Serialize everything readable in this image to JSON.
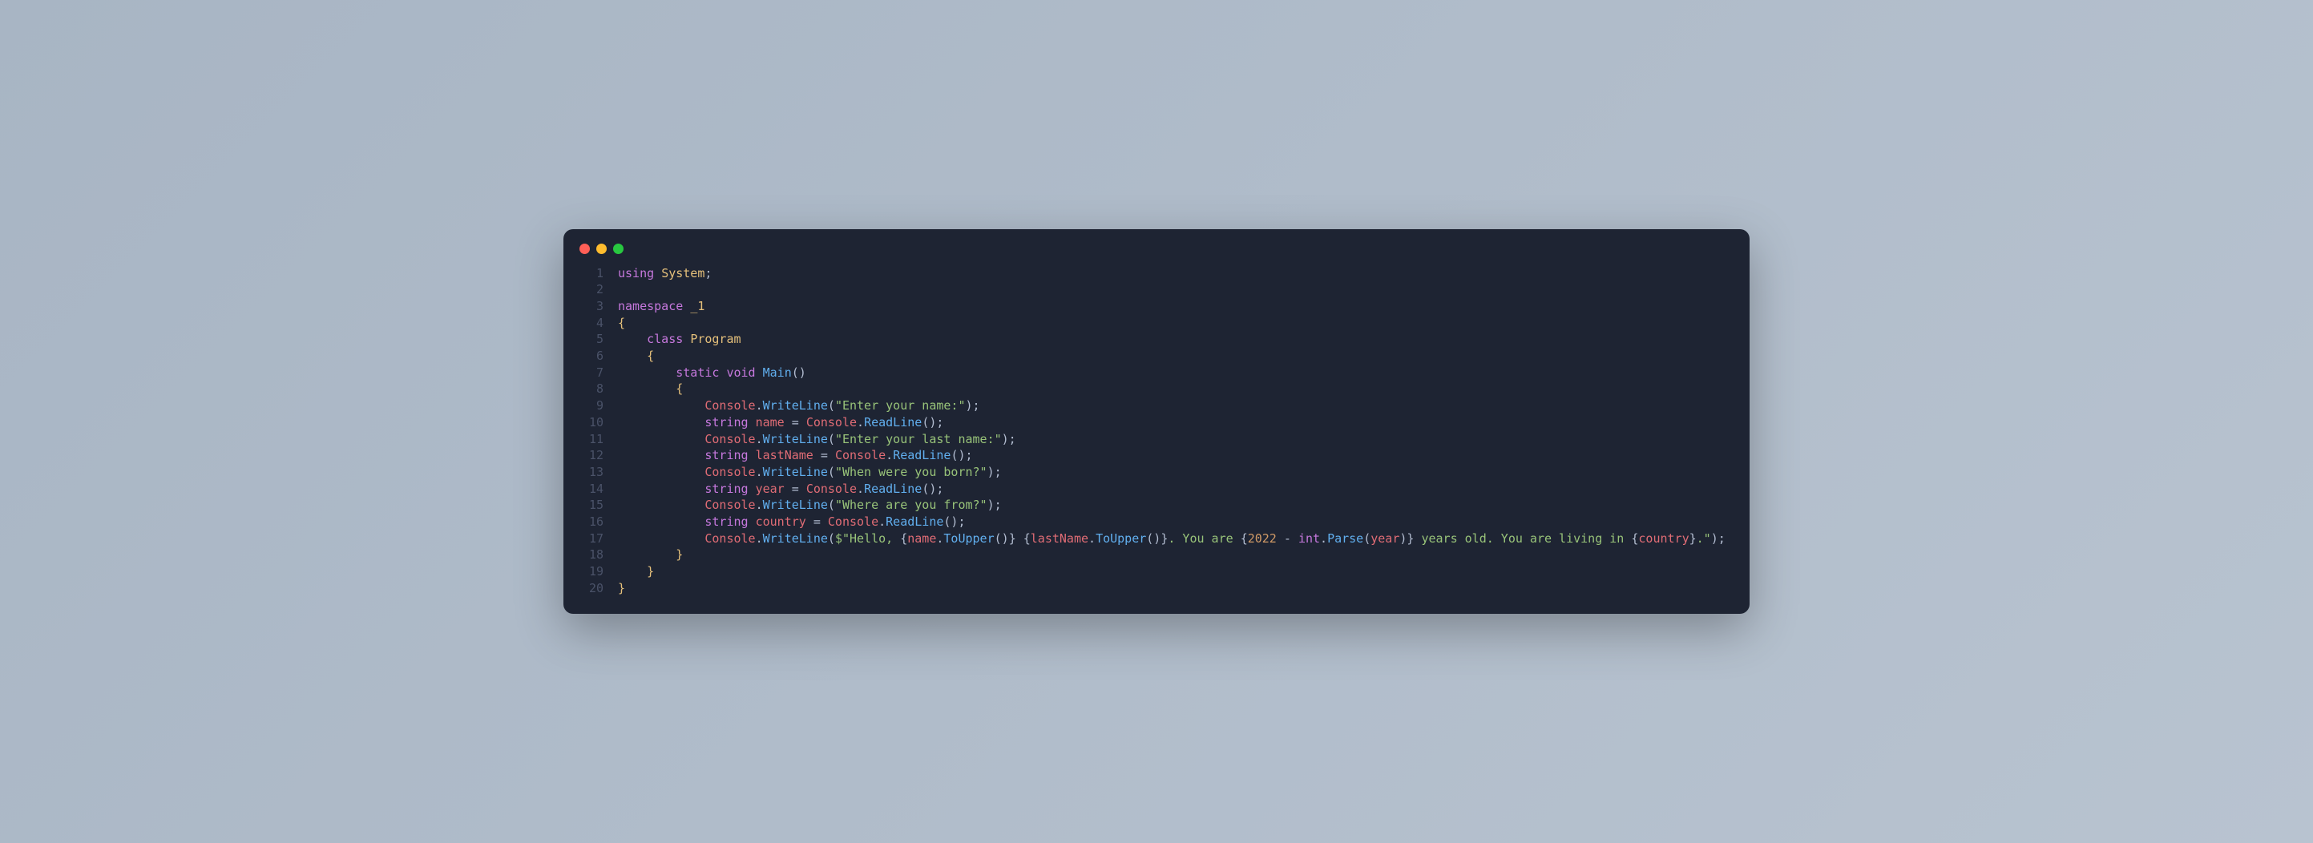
{
  "window": {
    "traffic_lights": [
      "close",
      "minimize",
      "maximize"
    ]
  },
  "code": {
    "language": "csharp",
    "lines": [
      {
        "n": 1,
        "tokens": [
          {
            "t": "using ",
            "c": "kw"
          },
          {
            "t": "System",
            "c": "type"
          },
          {
            "t": ";",
            "c": "punct"
          }
        ]
      },
      {
        "n": 2,
        "tokens": []
      },
      {
        "n": 3,
        "tokens": [
          {
            "t": "namespace ",
            "c": "kw"
          },
          {
            "t": "_1",
            "c": "type"
          }
        ]
      },
      {
        "n": 4,
        "tokens": [
          {
            "t": "{",
            "c": "brace"
          }
        ]
      },
      {
        "n": 5,
        "tokens": [
          {
            "t": "    ",
            "c": "punct"
          },
          {
            "t": "class ",
            "c": "kw"
          },
          {
            "t": "Program",
            "c": "type"
          }
        ]
      },
      {
        "n": 6,
        "tokens": [
          {
            "t": "    ",
            "c": "punct"
          },
          {
            "t": "{",
            "c": "brace"
          }
        ]
      },
      {
        "n": 7,
        "tokens": [
          {
            "t": "        ",
            "c": "punct"
          },
          {
            "t": "static ",
            "c": "kw"
          },
          {
            "t": "void ",
            "c": "kw"
          },
          {
            "t": "Main",
            "c": "method"
          },
          {
            "t": "()",
            "c": "punct"
          }
        ]
      },
      {
        "n": 8,
        "tokens": [
          {
            "t": "        ",
            "c": "punct"
          },
          {
            "t": "{",
            "c": "brace"
          }
        ]
      },
      {
        "n": 9,
        "tokens": [
          {
            "t": "            ",
            "c": "punct"
          },
          {
            "t": "Console",
            "c": "cls"
          },
          {
            "t": ".",
            "c": "punct"
          },
          {
            "t": "WriteLine",
            "c": "method"
          },
          {
            "t": "(",
            "c": "punct"
          },
          {
            "t": "\"Enter your name:\"",
            "c": "str"
          },
          {
            "t": ");",
            "c": "punct"
          }
        ]
      },
      {
        "n": 10,
        "tokens": [
          {
            "t": "            ",
            "c": "punct"
          },
          {
            "t": "string ",
            "c": "kw"
          },
          {
            "t": "name",
            "c": "var"
          },
          {
            "t": " = ",
            "c": "punct"
          },
          {
            "t": "Console",
            "c": "cls"
          },
          {
            "t": ".",
            "c": "punct"
          },
          {
            "t": "ReadLine",
            "c": "method"
          },
          {
            "t": "();",
            "c": "punct"
          }
        ]
      },
      {
        "n": 11,
        "tokens": [
          {
            "t": "            ",
            "c": "punct"
          },
          {
            "t": "Console",
            "c": "cls"
          },
          {
            "t": ".",
            "c": "punct"
          },
          {
            "t": "WriteLine",
            "c": "method"
          },
          {
            "t": "(",
            "c": "punct"
          },
          {
            "t": "\"Enter your last name:\"",
            "c": "str"
          },
          {
            "t": ");",
            "c": "punct"
          }
        ]
      },
      {
        "n": 12,
        "tokens": [
          {
            "t": "            ",
            "c": "punct"
          },
          {
            "t": "string ",
            "c": "kw"
          },
          {
            "t": "lastName",
            "c": "var"
          },
          {
            "t": " = ",
            "c": "punct"
          },
          {
            "t": "Console",
            "c": "cls"
          },
          {
            "t": ".",
            "c": "punct"
          },
          {
            "t": "ReadLine",
            "c": "method"
          },
          {
            "t": "();",
            "c": "punct"
          }
        ]
      },
      {
        "n": 13,
        "tokens": [
          {
            "t": "            ",
            "c": "punct"
          },
          {
            "t": "Console",
            "c": "cls"
          },
          {
            "t": ".",
            "c": "punct"
          },
          {
            "t": "WriteLine",
            "c": "method"
          },
          {
            "t": "(",
            "c": "punct"
          },
          {
            "t": "\"When were you born?\"",
            "c": "str"
          },
          {
            "t": ");",
            "c": "punct"
          }
        ]
      },
      {
        "n": 14,
        "tokens": [
          {
            "t": "            ",
            "c": "punct"
          },
          {
            "t": "string ",
            "c": "kw"
          },
          {
            "t": "year",
            "c": "var"
          },
          {
            "t": " = ",
            "c": "punct"
          },
          {
            "t": "Console",
            "c": "cls"
          },
          {
            "t": ".",
            "c": "punct"
          },
          {
            "t": "ReadLine",
            "c": "method"
          },
          {
            "t": "();",
            "c": "punct"
          }
        ]
      },
      {
        "n": 15,
        "tokens": [
          {
            "t": "            ",
            "c": "punct"
          },
          {
            "t": "Console",
            "c": "cls"
          },
          {
            "t": ".",
            "c": "punct"
          },
          {
            "t": "WriteLine",
            "c": "method"
          },
          {
            "t": "(",
            "c": "punct"
          },
          {
            "t": "\"Where are you from?\"",
            "c": "str"
          },
          {
            "t": ");",
            "c": "punct"
          }
        ]
      },
      {
        "n": 16,
        "tokens": [
          {
            "t": "            ",
            "c": "punct"
          },
          {
            "t": "string ",
            "c": "kw"
          },
          {
            "t": "country",
            "c": "var"
          },
          {
            "t": " = ",
            "c": "punct"
          },
          {
            "t": "Console",
            "c": "cls"
          },
          {
            "t": ".",
            "c": "punct"
          },
          {
            "t": "ReadLine",
            "c": "method"
          },
          {
            "t": "();",
            "c": "punct"
          }
        ]
      },
      {
        "n": 17,
        "tokens": [
          {
            "t": "            ",
            "c": "punct"
          },
          {
            "t": "Console",
            "c": "cls"
          },
          {
            "t": ".",
            "c": "punct"
          },
          {
            "t": "WriteLine",
            "c": "method"
          },
          {
            "t": "(",
            "c": "punct"
          },
          {
            "t": "$\"Hello, ",
            "c": "str"
          },
          {
            "t": "{",
            "c": "punct"
          },
          {
            "t": "name",
            "c": "var"
          },
          {
            "t": ".",
            "c": "punct"
          },
          {
            "t": "ToUpper",
            "c": "method"
          },
          {
            "t": "()",
            "c": "punct"
          },
          {
            "t": "}",
            "c": "punct"
          },
          {
            "t": " ",
            "c": "str"
          },
          {
            "t": "{",
            "c": "punct"
          },
          {
            "t": "lastName",
            "c": "var"
          },
          {
            "t": ".",
            "c": "punct"
          },
          {
            "t": "ToUpper",
            "c": "method"
          },
          {
            "t": "()",
            "c": "punct"
          },
          {
            "t": "}",
            "c": "punct"
          },
          {
            "t": ". You are ",
            "c": "str"
          },
          {
            "t": "{",
            "c": "punct"
          },
          {
            "t": "2022",
            "c": "num"
          },
          {
            "t": " - ",
            "c": "punct"
          },
          {
            "t": "int",
            "c": "kw"
          },
          {
            "t": ".",
            "c": "punct"
          },
          {
            "t": "Parse",
            "c": "method"
          },
          {
            "t": "(",
            "c": "punct"
          },
          {
            "t": "year",
            "c": "var"
          },
          {
            "t": ")",
            "c": "punct"
          },
          {
            "t": "}",
            "c": "punct"
          },
          {
            "t": " years old. You are living in ",
            "c": "str"
          },
          {
            "t": "{",
            "c": "punct"
          },
          {
            "t": "country",
            "c": "var"
          },
          {
            "t": "}",
            "c": "punct"
          },
          {
            "t": ".\"",
            "c": "str"
          },
          {
            "t": ");",
            "c": "punct"
          }
        ]
      },
      {
        "n": 18,
        "tokens": [
          {
            "t": "        ",
            "c": "punct"
          },
          {
            "t": "}",
            "c": "brace"
          }
        ]
      },
      {
        "n": 19,
        "tokens": [
          {
            "t": "    ",
            "c": "punct"
          },
          {
            "t": "}",
            "c": "brace"
          }
        ]
      },
      {
        "n": 20,
        "tokens": [
          {
            "t": "}",
            "c": "brace"
          }
        ]
      }
    ]
  }
}
